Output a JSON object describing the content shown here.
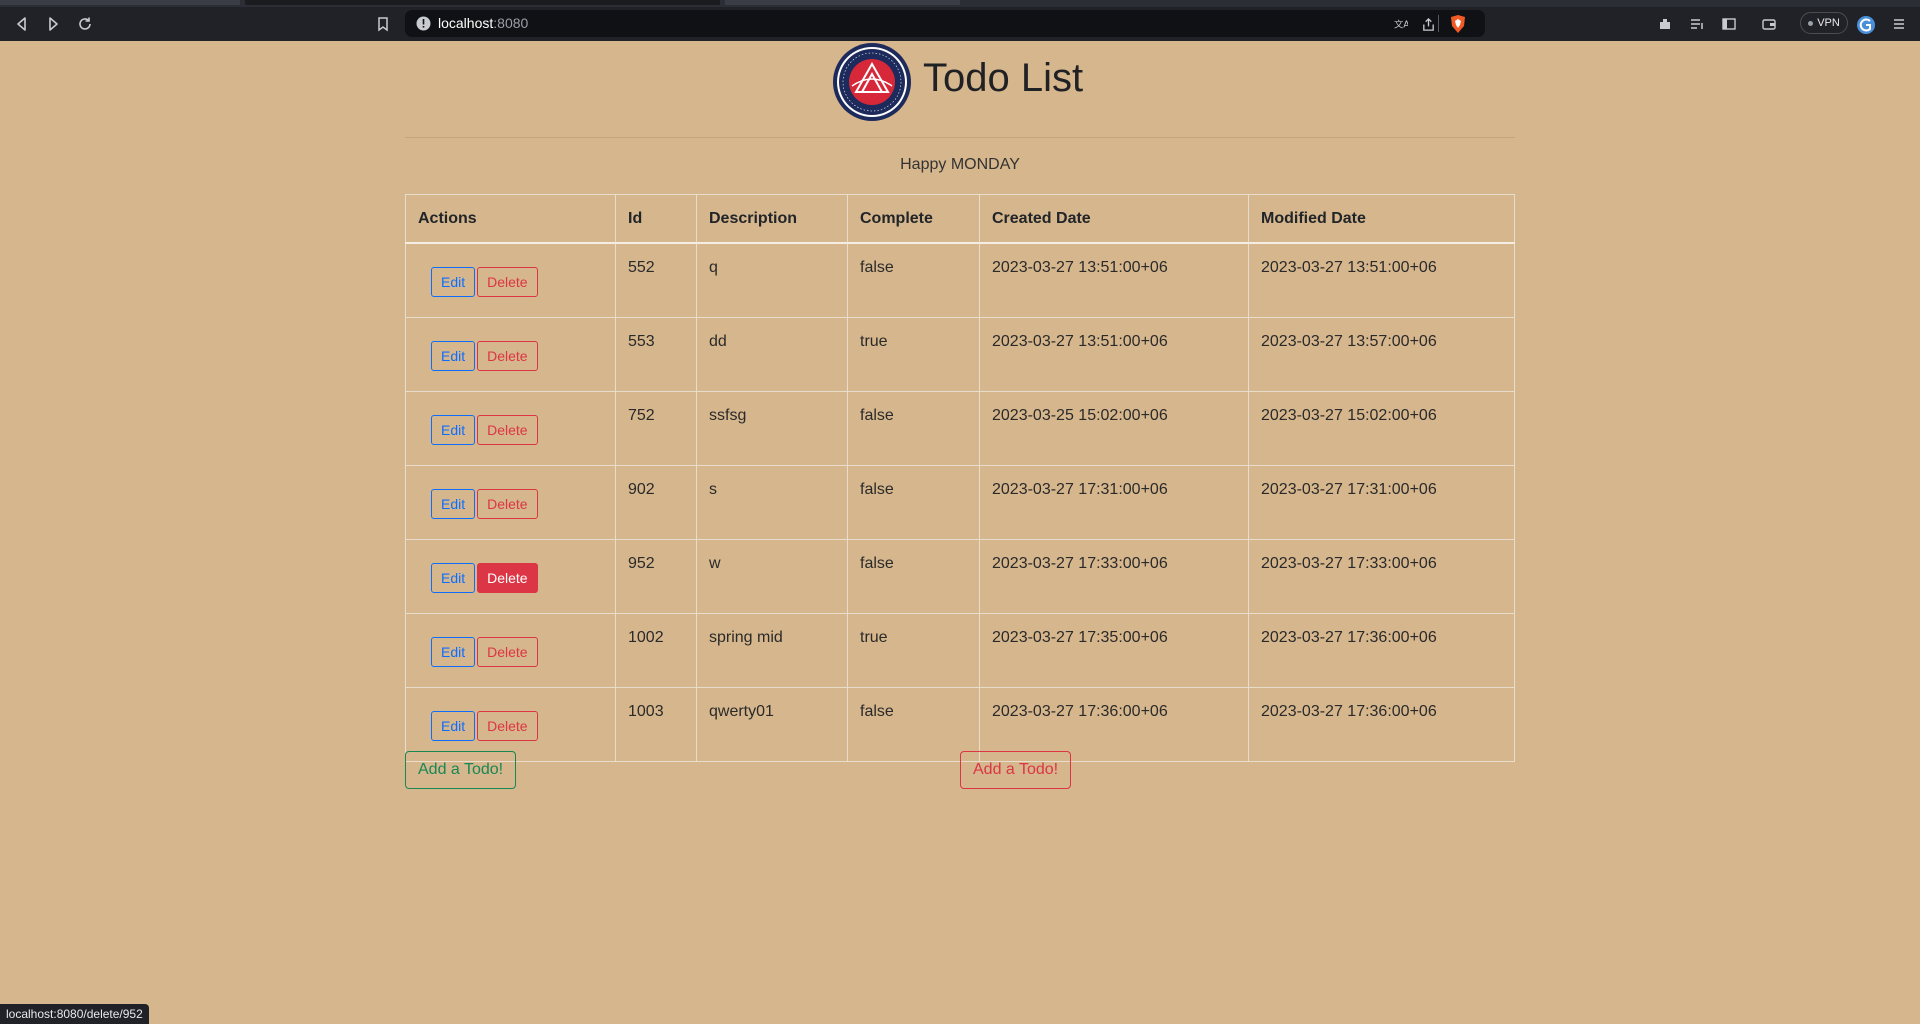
{
  "browser": {
    "url_host": "localhost",
    "url_port": ":8080",
    "vpn_label": "VPN",
    "status_url": "localhost:8080/delete/952"
  },
  "page": {
    "title": "Todo List",
    "greeting": "Happy MONDAY",
    "logo_text": "ALA-TOO INTERNATIONAL UNIVERSITY"
  },
  "table": {
    "headers": [
      "Actions",
      "Id",
      "Description",
      "Complete",
      "Created Date",
      "Modified Date"
    ],
    "edit_label": "Edit",
    "delete_label": "Delete",
    "rows": [
      {
        "id": "552",
        "description": "q",
        "complete": "false",
        "created": "2023-03-27 13:51:00+06",
        "modified": "2023-03-27 13:51:00+06"
      },
      {
        "id": "553",
        "description": "dd",
        "complete": "true",
        "created": "2023-03-27 13:51:00+06",
        "modified": "2023-03-27 13:57:00+06"
      },
      {
        "id": "752",
        "description": "ssfsg",
        "complete": "false",
        "created": "2023-03-25 15:02:00+06",
        "modified": "2023-03-27 15:02:00+06"
      },
      {
        "id": "902",
        "description": "s",
        "complete": "false",
        "created": "2023-03-27 17:31:00+06",
        "modified": "2023-03-27 17:31:00+06"
      },
      {
        "id": "952",
        "description": "w",
        "complete": "false",
        "created": "2023-03-27 17:33:00+06",
        "modified": "2023-03-27 17:33:00+06"
      },
      {
        "id": "1002",
        "description": "spring mid",
        "complete": "true",
        "created": "2023-03-27 17:35:00+06",
        "modified": "2023-03-27 17:36:00+06"
      },
      {
        "id": "1003",
        "description": "qwerty01",
        "complete": "false",
        "created": "2023-03-27 17:36:00+06",
        "modified": "2023-03-27 17:36:00+06"
      }
    ]
  },
  "buttons": {
    "add_green_label": "Add a Todo!",
    "add_red_label": "Add a Todo!"
  },
  "colors": {
    "page_bg": "#d6b68c",
    "edit": "#0d6efd",
    "delete": "#dc3545",
    "add_green": "#198754"
  }
}
